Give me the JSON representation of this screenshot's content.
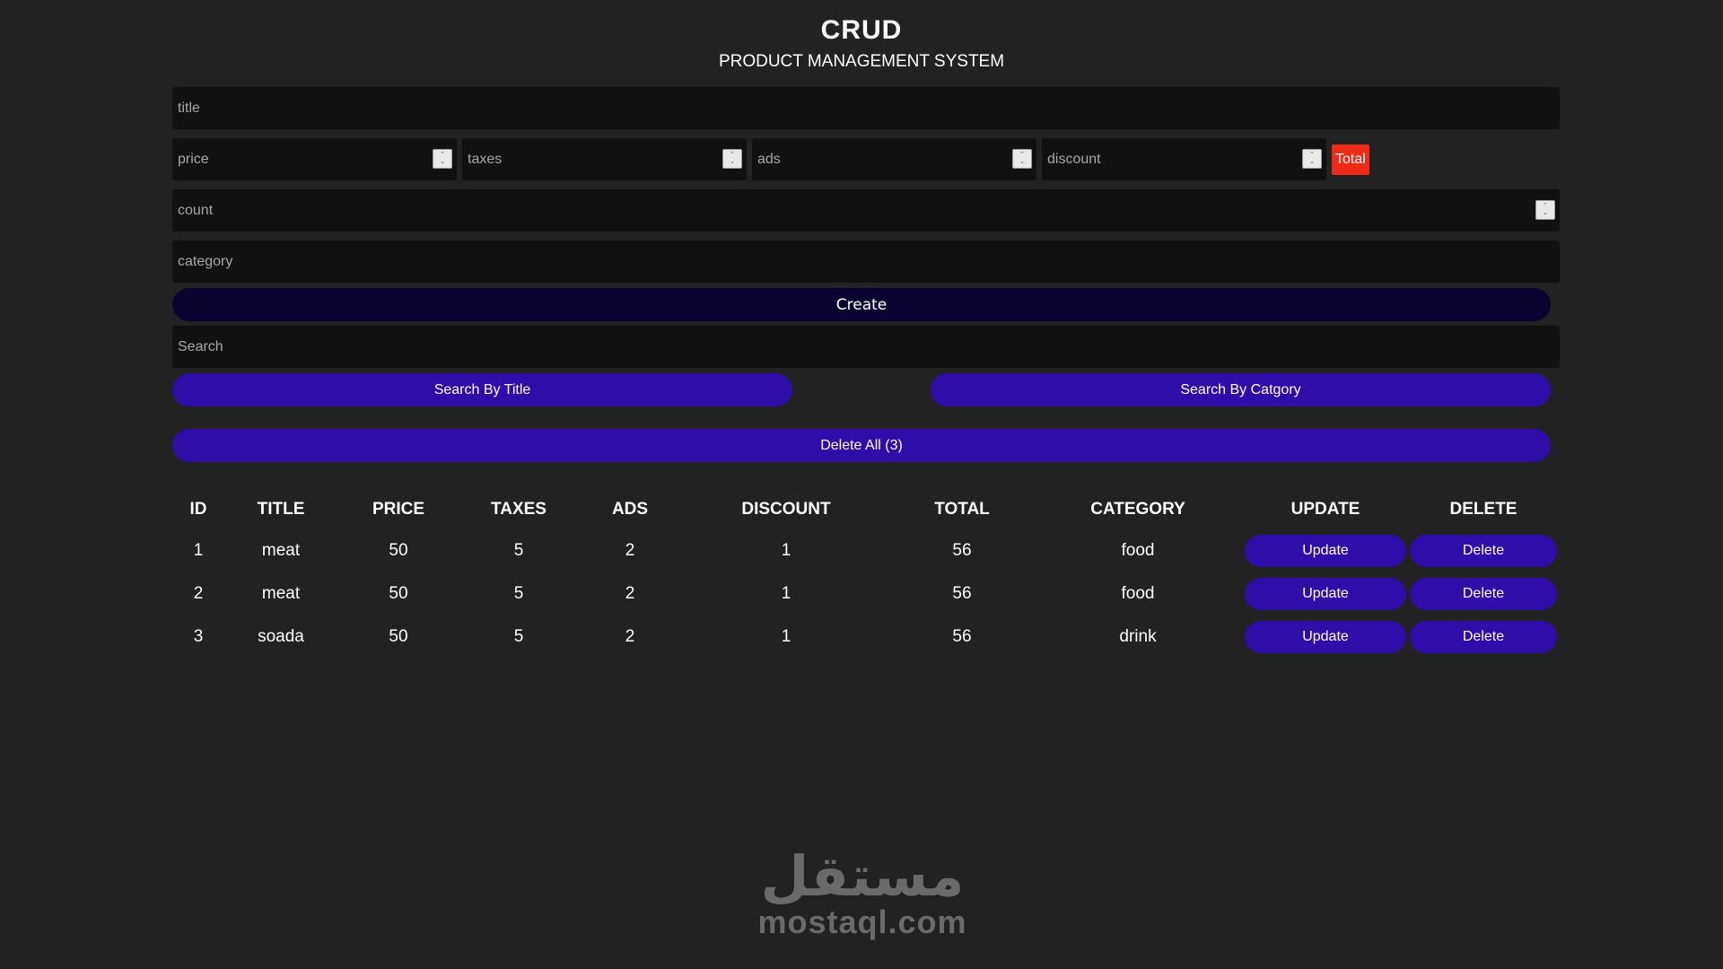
{
  "header": {
    "title": "CRUD",
    "subtitle": "PRODUCT MANAGEMENT SYSTEM"
  },
  "form": {
    "title_placeholder": "title",
    "price_placeholder": "price",
    "taxes_placeholder": "taxes",
    "ads_placeholder": "ads",
    "discount_placeholder": "discount",
    "total_label": "Total",
    "count_placeholder": "count",
    "category_placeholder": "category",
    "create_label": "Create"
  },
  "search": {
    "placeholder": "Search",
    "by_title_label": "Search By Title",
    "by_category_label": "Search By Catgory"
  },
  "delete_all_label": "Delete All (3)",
  "table": {
    "headers": [
      "ID",
      "TITLE",
      "PRICE",
      "TAXES",
      "ADS",
      "DISCOUNT",
      "TOTAL",
      "CATEGORY",
      "UPDATE",
      "DELETE"
    ],
    "rows": [
      {
        "id": "1",
        "title": "meat",
        "price": "50",
        "taxes": "5",
        "ads": "2",
        "discount": "1",
        "total": "56",
        "category": "food",
        "update": "Update",
        "delete": "Delete"
      },
      {
        "id": "2",
        "title": "meat",
        "price": "50",
        "taxes": "5",
        "ads": "2",
        "discount": "1",
        "total": "56",
        "category": "food",
        "update": "Update",
        "delete": "Delete"
      },
      {
        "id": "3",
        "title": "soada",
        "price": "50",
        "taxes": "5",
        "ads": "2",
        "discount": "1",
        "total": "56",
        "category": "drink",
        "update": "Update",
        "delete": "Delete"
      }
    ]
  },
  "watermark": {
    "arabic": "مستقل",
    "latin": "mostaql.com"
  },
  "colors": {
    "background": "#222222",
    "input_bg": "#111111",
    "button_purple": "#2e0da8",
    "create_bg": "#0a0330",
    "total_red": "#ee2a18"
  }
}
